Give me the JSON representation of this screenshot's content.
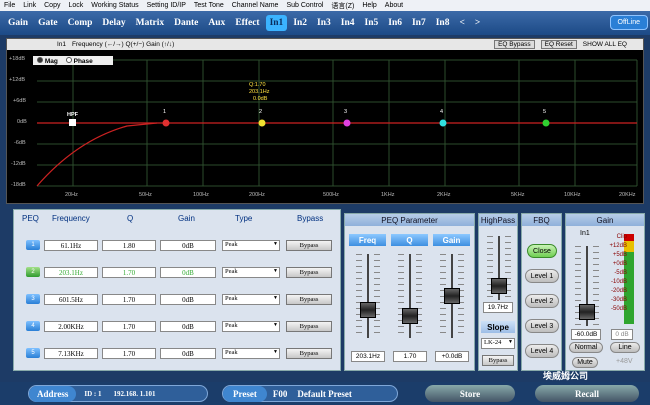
{
  "menu": [
    "File",
    "Link",
    "Copy",
    "Lock",
    "Working Status",
    "Setting ID/IP",
    "Test Tone",
    "Channel Name",
    "Sub Control",
    "语言(Z)",
    "Help",
    "About"
  ],
  "tabs": [
    "Gain",
    "Gate",
    "Comp",
    "Delay",
    "Matrix",
    "Dante",
    "Aux",
    "Effect",
    "In1",
    "In2",
    "In3",
    "In4",
    "In5",
    "In6",
    "In7",
    "In8",
    "<",
    ">"
  ],
  "active_tab": "In1",
  "offline_label": "OffLine",
  "graph": {
    "channel": "In1",
    "hint": "Frequency (←/→) Q(+/−) Gain (↑/↓)",
    "eq_bypass": "EQ Bypass",
    "eq_reset": "EQ Reset",
    "show_all": "SHOW ALL EQ",
    "mode_mag": "Mag",
    "mode_phase": "Phase",
    "y_labels": [
      "+18dB",
      "+12dB",
      "+6dB",
      "0dB",
      "-6dB",
      "-12dB",
      "-18dB"
    ],
    "x_labels": [
      "20Hz",
      "50Hz",
      "100Hz",
      "200Hz",
      "500Hz",
      "1KHz",
      "2KHz",
      "5KHz",
      "10KHz",
      "20KHz"
    ],
    "points": [
      "HPF",
      "1",
      "2",
      "3",
      "4",
      "5"
    ],
    "tooltip": [
      "Q:1.70",
      "203.1Hz",
      "0.0dB"
    ]
  },
  "peq": {
    "headers": [
      "PEQ",
      "Frequency",
      "Q",
      "Gain",
      "Type",
      "Bypass"
    ],
    "rows": [
      {
        "n": "1",
        "freq": "61.1Hz",
        "q": "1.80",
        "gain": "0dB",
        "type": "Peak",
        "bypass": "Bypass"
      },
      {
        "n": "2",
        "freq": "203.1Hz",
        "q": "1.70",
        "gain": "0dB",
        "type": "Peak",
        "bypass": "Bypass"
      },
      {
        "n": "3",
        "freq": "601.5Hz",
        "q": "1.70",
        "gain": "0dB",
        "type": "Peak",
        "bypass": "Bypass"
      },
      {
        "n": "4",
        "freq": "2.00KHz",
        "q": "1.70",
        "gain": "0dB",
        "type": "Peak",
        "bypass": "Bypass"
      },
      {
        "n": "5",
        "freq": "7.13KHz",
        "q": "1.70",
        "gain": "0dB",
        "type": "Peak",
        "bypass": "Bypass"
      }
    ]
  },
  "peq_param": {
    "title": "PEQ Parameter",
    "freq": "Freq",
    "q": "Q",
    "gain": "Gain",
    "freq_val": "203.1Hz",
    "q_val": "1.70",
    "gain_val": "+0.0dB"
  },
  "highpass": {
    "title": "HighPass",
    "value": "19.7Hz",
    "slope": "Slope",
    "slope_val": "LK-24",
    "bypass": "Bypass"
  },
  "fbq": {
    "title": "FBQ",
    "close": "Close",
    "levels": [
      "Level 1",
      "Level 2",
      "Level 3",
      "Level 4"
    ]
  },
  "gainpanel": {
    "title": "Gain",
    "channel": "In1",
    "value": "-60.0dB",
    "db_small": "0 dB",
    "normal": "Normal",
    "line": "Line",
    "mute": "Mute",
    "phantom": "+48V",
    "meter_labels": [
      "Clip",
      "+12dB",
      "+5dB",
      "+0dB",
      "-5dB",
      "-10dB",
      "-20dB",
      "-30dB",
      "-50dB"
    ]
  },
  "bottom": {
    "address": "Address",
    "id": "ID : 1",
    "ip": "192.168.  1.101",
    "preset": "Preset",
    "preset_no": "F00",
    "preset_name": "Default Preset",
    "store": "Store",
    "recall": "Recall",
    "watermark": "埃威姆公司"
  }
}
